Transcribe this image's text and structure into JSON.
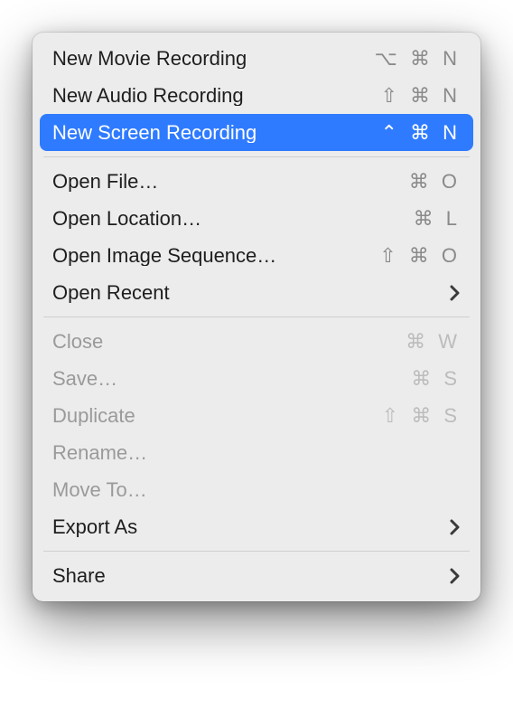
{
  "menu": {
    "items": [
      {
        "label": "New Movie Recording",
        "shortcut": "⌥ ⌘ N",
        "submenu": false,
        "enabled": true,
        "selected": false
      },
      {
        "label": "New Audio Recording",
        "shortcut": "⇧ ⌘ N",
        "submenu": false,
        "enabled": true,
        "selected": false
      },
      {
        "label": "New Screen Recording",
        "shortcut": "⌃ ⌘ N",
        "submenu": false,
        "enabled": true,
        "selected": true
      },
      {
        "separator": true
      },
      {
        "label": "Open File…",
        "shortcut": "⌘ O",
        "submenu": false,
        "enabled": true,
        "selected": false
      },
      {
        "label": "Open Location…",
        "shortcut": "⌘ L",
        "submenu": false,
        "enabled": true,
        "selected": false
      },
      {
        "label": "Open Image Sequence…",
        "shortcut": "⇧ ⌘ O",
        "submenu": false,
        "enabled": true,
        "selected": false
      },
      {
        "label": "Open Recent",
        "shortcut": "",
        "submenu": true,
        "enabled": true,
        "selected": false
      },
      {
        "separator": true
      },
      {
        "label": "Close",
        "shortcut": "⌘ W",
        "submenu": false,
        "enabled": false,
        "selected": false
      },
      {
        "label": "Save…",
        "shortcut": "⌘ S",
        "submenu": false,
        "enabled": false,
        "selected": false
      },
      {
        "label": "Duplicate",
        "shortcut": "⇧ ⌘ S",
        "submenu": false,
        "enabled": false,
        "selected": false
      },
      {
        "label": "Rename…",
        "shortcut": "",
        "submenu": false,
        "enabled": false,
        "selected": false
      },
      {
        "label": "Move To…",
        "shortcut": "",
        "submenu": false,
        "enabled": false,
        "selected": false
      },
      {
        "label": "Export As",
        "shortcut": "",
        "submenu": true,
        "enabled": true,
        "selected": false
      },
      {
        "separator": true
      },
      {
        "label": "Share",
        "shortcut": "",
        "submenu": true,
        "enabled": true,
        "selected": false
      }
    ]
  }
}
